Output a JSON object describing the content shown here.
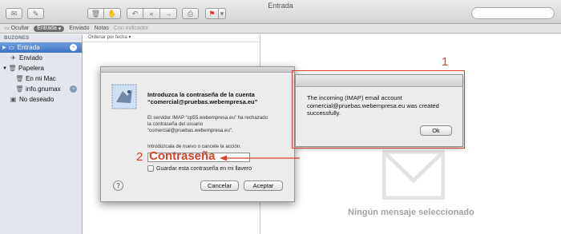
{
  "window": {
    "title": "Entrada"
  },
  "favorites_bar": {
    "hide_label": "Ocultar",
    "inbox_label": "Entrada",
    "sent_label": "Enviado",
    "notes_label": "Notas",
    "flagged_label": "Con indicador"
  },
  "sidebar": {
    "header": "BUZONES",
    "items": [
      {
        "label": "Entrada",
        "icon": "inbox-tray-icon",
        "selected": true
      },
      {
        "label": "Enviado",
        "icon": "paper-plane-icon"
      },
      {
        "label": "Papelera",
        "icon": "trash-icon"
      },
      {
        "label": "En mi Mac",
        "icon": "trash-icon"
      },
      {
        "label": "info.gnumax",
        "icon": "trash-icon"
      },
      {
        "label": "No deseado",
        "icon": "junk-icon"
      }
    ]
  },
  "message_list": {
    "sort_label": "Ordenar por fecha ▾"
  },
  "preview": {
    "empty_text": "Ningún mensaje seleccionado"
  },
  "password_dialog": {
    "title_line1": "Introduzca la contraseña de la cuenta",
    "title_line2": "“comercial@pruebas.webempresa.eu”",
    "message_line1": "El servidor IMAP “cp55.webempresa.eu” ha rechazado",
    "message_line2": "la contraseña del usuario",
    "message_line3": "“comercial@pruebas.webempresa.eu”.",
    "prompt": "Introdúzcala de nuevo o cancele la acción.",
    "password_value": "",
    "remember_label": "Guardar esta contraseña en mi llavero",
    "help_label": "?",
    "cancel_label": "Cancelar",
    "accept_label": "Aceptar"
  },
  "success_dialog": {
    "line1": "The incoming (IMAP) email account",
    "line2": "comercial@pruebas.webempresa.eu was created",
    "line3": "successfully.",
    "ok_label": "Ok"
  },
  "annotations": {
    "num1": "1",
    "num2": "2",
    "password_word": "Contraseña",
    "color": "#d6422a"
  }
}
